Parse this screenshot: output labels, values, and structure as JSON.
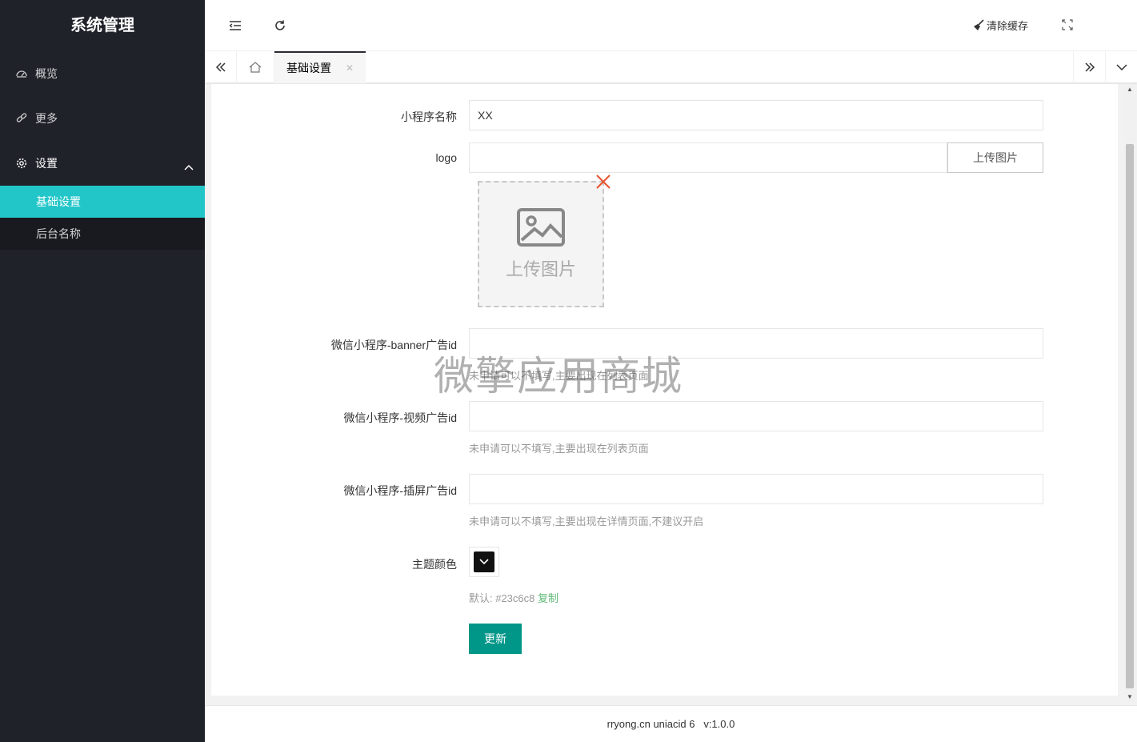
{
  "sidebar": {
    "title": "系统管理",
    "items": [
      {
        "label": "概览",
        "icon": "dashboard-icon"
      },
      {
        "label": "更多",
        "icon": "link-icon"
      },
      {
        "label": "设置",
        "icon": "gear-icon"
      }
    ],
    "sub_items": [
      {
        "label": "基础设置",
        "active": true
      },
      {
        "label": "后台名称",
        "active": false
      }
    ],
    "active_color": "#23c6c8"
  },
  "header": {
    "clear_cache_label": "清除缓存"
  },
  "tabs": {
    "active_tab_label": "基础设置"
  },
  "form": {
    "app_name": {
      "label": "小程序名称",
      "value": "XX"
    },
    "logo": {
      "label": "logo",
      "value": "",
      "upload_button": "上传图片",
      "preview_text": "上传图片"
    },
    "banner_ad": {
      "label": "微信小程序-banner广告id",
      "value": "",
      "hint": "未申请可以不填写,主要出现在列表页面"
    },
    "video_ad": {
      "label": "微信小程序-视频广告id",
      "value": "",
      "hint": "未申请可以不填写,主要出现在列表页面"
    },
    "interstitial_ad": {
      "label": "微信小程序-插屏广告id",
      "value": "",
      "hint": "未申请可以不填写,主要出现在详情页面,不建议开启"
    },
    "theme_color": {
      "label": "主题颜色",
      "default_prefix": "默认: #23c6c8",
      "copy_label": "复制",
      "default_color": "#23c6c8"
    },
    "submit_label": "更新",
    "submit_color": "#009688"
  },
  "watermark": "微擎应用商城",
  "footer": {
    "text": "rryong.cn uniacid 6   v:1.0.0"
  }
}
